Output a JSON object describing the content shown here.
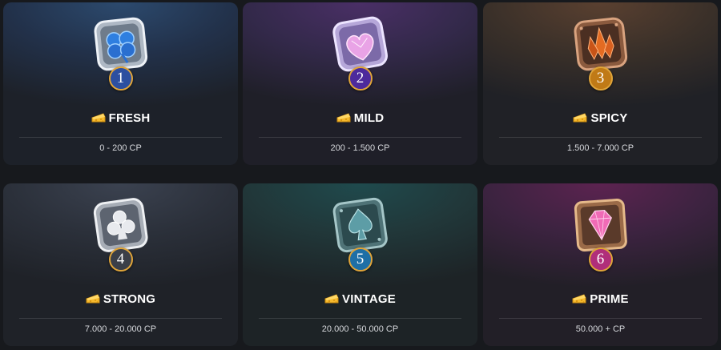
{
  "tiers": [
    {
      "level": "1",
      "name": "FRESH",
      "range": "0 - 200 CP",
      "icon": "clover-gem-icon",
      "badge_color": "#2c4fa0",
      "frame_color": "#b9c3cf",
      "gem_color": "#2f7fe0"
    },
    {
      "level": "2",
      "name": "MILD",
      "range": "200 - 1.500 CP",
      "icon": "heart-gem-icon",
      "badge_color": "#4d2a9c",
      "frame_color": "#c7b5e8",
      "gem_color": "#e9a3e6"
    },
    {
      "level": "3",
      "name": "SPICY",
      "range": "1.500 - 7.000 CP",
      "icon": "crystal-icon",
      "badge_color": "#c07a16",
      "frame_color": "#a9714f",
      "gem_color": "#e36b22"
    },
    {
      "level": "4",
      "name": "STRONG",
      "range": "7.000 - 20.000 CP",
      "icon": "club-icon",
      "badge_color": "#3b3f48",
      "frame_color": "#c9cdd3",
      "gem_color": "#e8eaee"
    },
    {
      "level": "5",
      "name": "VINTAGE",
      "range": "20.000 - 50.000 CP",
      "icon": "spade-icon",
      "badge_color": "#1e6fa6",
      "frame_color": "#7aa2a6",
      "gem_color": "#5d9da6"
    },
    {
      "level": "6",
      "name": "PRIME",
      "range": "50.000 + CP",
      "icon": "diamond-gem-icon",
      "badge_color": "#b02e7a",
      "frame_color": "#b5805a",
      "gem_color": "#f06bb6"
    }
  ]
}
